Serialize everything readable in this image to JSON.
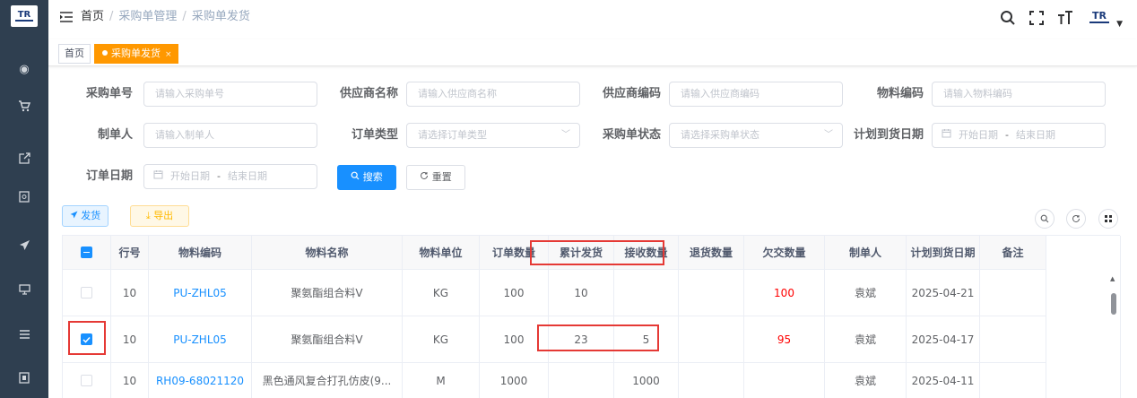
{
  "header": {
    "breadcrumb": [
      "首页",
      "采购单管理",
      "采购单发货"
    ],
    "breadcrumb_sep": "/"
  },
  "tags": {
    "home": "首页",
    "active": "采购单发货",
    "close": "×"
  },
  "filters": {
    "order_no": {
      "label": "采购单号",
      "placeholder": "请输入采购单号"
    },
    "supplier_name": {
      "label": "供应商名称",
      "placeholder": "请输入供应商名称"
    },
    "supplier_code": {
      "label": "供应商编码",
      "placeholder": "请输入供应商编码"
    },
    "material_code": {
      "label": "物料编码",
      "placeholder": "请输入物料编码"
    },
    "creator": {
      "label": "制单人",
      "placeholder": "请输入制单人"
    },
    "order_type": {
      "label": "订单类型",
      "placeholder": "请选择订单类型"
    },
    "order_status": {
      "label": "采购单状态",
      "placeholder": "请选择采购单状态"
    },
    "planned_date": {
      "label": "计划到货日期",
      "start": "开始日期",
      "dash": "-",
      "end": "结束日期"
    },
    "order_date": {
      "label": "订单日期",
      "start": "开始日期",
      "dash": "-",
      "end": "结束日期"
    }
  },
  "actions": {
    "search": "搜索",
    "reset": "重置",
    "ship": "发货",
    "export": "导出"
  },
  "table": {
    "columns": [
      "行号",
      "物料编码",
      "物料名称",
      "物料单位",
      "订单数量",
      "累计发货",
      "接收数量",
      "退货数量",
      "欠交数量",
      "制单人",
      "计划到货日期",
      "备注"
    ],
    "rows": [
      {
        "checked": false,
        "line": "10",
        "code": "PU-ZHL05",
        "name": "聚氨酯组合料V",
        "unit": "KG",
        "qty": "100",
        "shipped": "10",
        "received": "",
        "returned": "",
        "short": "100",
        "creator": "袁斌",
        "date": "2025-04-21",
        "remark": ""
      },
      {
        "checked": true,
        "line": "10",
        "code": "PU-ZHL05",
        "name": "聚氨酯组合料V",
        "unit": "KG",
        "qty": "100",
        "shipped": "23",
        "received": "5",
        "returned": "",
        "short": "95",
        "creator": "袁斌",
        "date": "2025-04-17",
        "remark": ""
      },
      {
        "checked": false,
        "line": "10",
        "code": "RH09-68021120",
        "name": "黑色通风复合打孔仿皮(9...",
        "unit": "M",
        "qty": "1000",
        "shipped": "",
        "received": "1000",
        "returned": "",
        "short": "",
        "creator": "袁斌",
        "date": "2025-04-11",
        "remark": ""
      }
    ]
  },
  "colors": {
    "primary": "#1890ff",
    "sidebar": "#2f3f50",
    "tag_active": "#ff9800",
    "danger": "#ff0000",
    "highlight": "#e53935"
  }
}
